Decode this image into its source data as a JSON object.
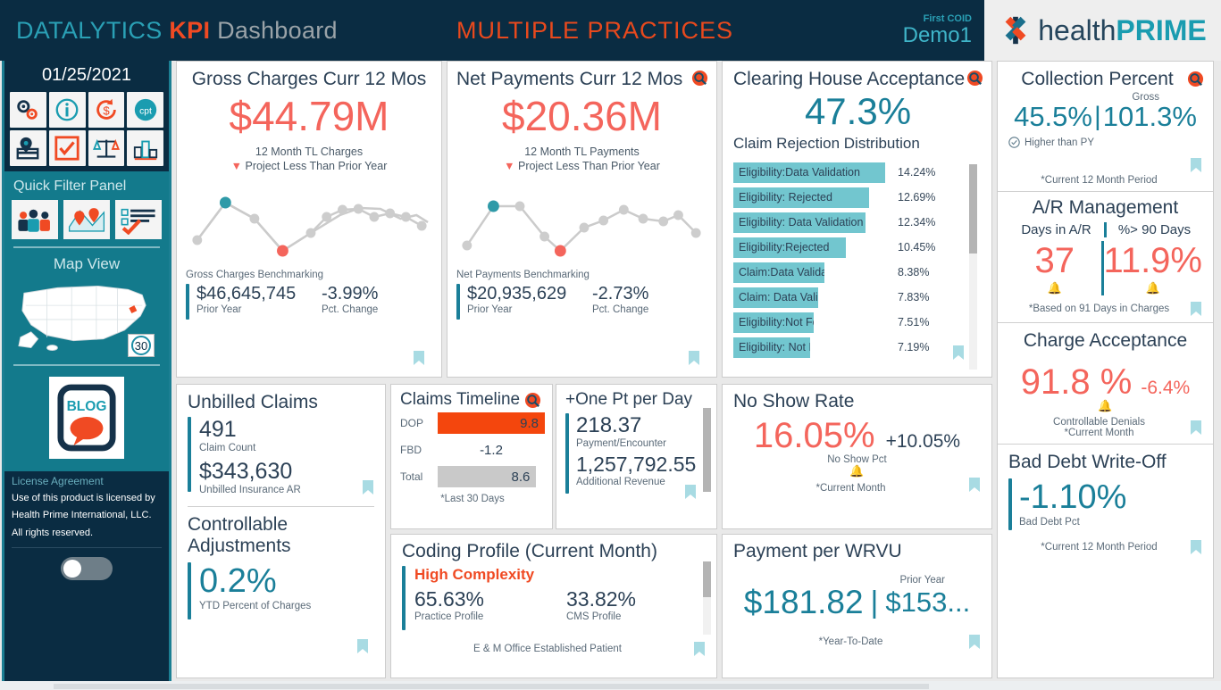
{
  "header": {
    "brand_1": "DATALYTICS",
    "brand_2": "KPI",
    "brand_3": "Dashboard",
    "center_title": "MULTIPLE PRACTICES",
    "coid_label": "First COID",
    "coid_value": "Demo1",
    "logo_1": "health",
    "logo_2": "PRIME",
    "accent_teal": "#1a9cb0",
    "accent_orange": "#f04a23",
    "bg": "#0a2c42"
  },
  "sidebar": {
    "date": "01/25/2021",
    "tiles": [
      {
        "name": "gears-icon"
      },
      {
        "name": "info-icon"
      },
      {
        "name": "refund-dollar-icon"
      },
      {
        "name": "cpt-icon"
      },
      {
        "name": "location-card-icon"
      },
      {
        "name": "checkbox-icon"
      },
      {
        "name": "scales-icon"
      },
      {
        "name": "podium-icon"
      }
    ],
    "quick_filter_title": "Quick Filter Panel",
    "quick_filter_icons": [
      {
        "name": "people-group-icon"
      },
      {
        "name": "map-pins-icon"
      },
      {
        "name": "checklist-icon"
      }
    ],
    "map_title": "Map View",
    "map_badge": "30",
    "blog_label": "BLOG",
    "license_title": "License Agreement",
    "license_text": "Use of this product is licensed by Health Prime International, LLC.  All rights reserved.",
    "toggle_state": "off"
  },
  "cards": {
    "gross_charges": {
      "title": "Gross Charges Curr 12 Mos",
      "value": "$44.79M",
      "sub1": "12 Month TL Charges",
      "trend_arrow": "▼",
      "sub2": "Project Less Than Prior Year",
      "bench_title": "Gross Charges Benchmarking",
      "prior_value": "$46,645,745",
      "prior_label": "Prior Year",
      "pct_value": "-3.99%",
      "pct_label": "Pct. Change"
    },
    "net_payments": {
      "title": "Net Payments Curr 12 Mos",
      "value": "$20.36M",
      "sub1": "12 Month TL Payments",
      "trend_arrow": "▼",
      "sub2": "Project Less Than Prior Year",
      "bench_title": "Net Payments Benchmarking",
      "prior_value": "$20,935,629",
      "prior_label": "Prior Year",
      "pct_value": "-2.73%",
      "pct_label": "Pct. Change"
    },
    "clearing_house": {
      "title": "Clearing House Acceptance",
      "value": "47.3%",
      "dist_title": "Claim Rejection Distribution",
      "rows": [
        {
          "label": "Eligibility:Data Validation",
          "pct": "14.24%"
        },
        {
          "label": "Eligibility: Rejected",
          "pct": "12.69%"
        },
        {
          "label": "Eligibility: Data Validation",
          "pct": "12.34%"
        },
        {
          "label": "Eligibility:Rejected",
          "pct": "10.45%"
        },
        {
          "label": "Claim:Data Validation",
          "pct": "8.38%"
        },
        {
          "label": "Claim: Data Validation",
          "pct": "7.83%"
        },
        {
          "label": "Eligibility:Not Found",
          "pct": "7.51%"
        },
        {
          "label": "Eligibility: Not Found",
          "pct": "7.19%"
        }
      ]
    },
    "collection_percent": {
      "title": "Collection Percent",
      "value": "45.5%",
      "gross_label": "Gross",
      "gross_value": "101.3%",
      "status": "Higher than PY",
      "note": "*Current 12 Month Period"
    },
    "ar_management": {
      "title": "A/R Management",
      "col1_label": "Days in A/R",
      "col2_label": "%> 90 Days",
      "col1_value": "37",
      "col2_value": "11.9%",
      "note": "*Based on 91 Days in Charges"
    },
    "charge_acceptance": {
      "title": "Charge Acceptance",
      "value": "91.8 %",
      "delta": "-6.4%",
      "sub": "Controllable Denials",
      "note": "*Current Month"
    },
    "bad_debt": {
      "title": "Bad Debt Write-Off",
      "value": "-1.10%",
      "sub": "Bad Debt Pct",
      "note": "*Current 12 Month Period"
    },
    "unbilled_claims": {
      "title": "Unbilled Claims",
      "value1": "491",
      "label1": "Claim Count",
      "value2": "$343,630",
      "label2": "Unbilled Insurance AR"
    },
    "controllable_adjustments": {
      "title": "Controllable Adjustments",
      "value": "0.2%",
      "label": "YTD Percent of Charges"
    },
    "claims_timeline": {
      "title": "Claims Timeline",
      "rows": [
        {
          "label": "DOP",
          "value": "9.8",
          "style": "orange"
        },
        {
          "label": "FBD",
          "value": "-1.2",
          "style": "plain"
        },
        {
          "label": "Total",
          "value": "8.6",
          "style": "gray"
        }
      ],
      "note": "*Last 30 Days"
    },
    "one_pt_per_day": {
      "title": "+One Pt per Day",
      "value1": "218.37",
      "label1": "Payment/Encounter",
      "value2": "1,257,792.55",
      "label2": "Additional Revenue"
    },
    "coding_profile": {
      "title": "Coding Profile (Current Month)",
      "complexity": "High Complexity",
      "value1": "65.63%",
      "label1": "Practice Profile",
      "value2": "33.82%",
      "label2": "CMS Profile",
      "footer": "E & M Office Established Patient"
    },
    "no_show_rate": {
      "title": "No Show Rate",
      "value": "16.05%",
      "delta": "+10.05%",
      "sub": "No Show Pct",
      "note": "*Current Month"
    },
    "payment_per_wrvu": {
      "title": "Payment per WRVU",
      "value": "$181.82",
      "prior_label": "Prior Year",
      "prior_value": "$153...",
      "note": "*Year-To-Date"
    }
  },
  "chart_data": [
    {
      "type": "line",
      "title": "Gross Charges Curr 12 Mos sparkline",
      "x": [
        1,
        2,
        3,
        4,
        5,
        6,
        7,
        8,
        9,
        10,
        11,
        12,
        13
      ],
      "values": [
        22,
        72,
        55,
        12,
        33,
        52,
        62,
        60,
        50,
        55,
        45,
        50,
        38
      ],
      "point_colors": [
        "#c9c9c9",
        "#2f9aa8",
        "#c9c9c9",
        "#f4655c",
        "#c9c9c9",
        "#c9c9c9",
        "#c9c9c9",
        "#c9c9c9",
        "#c9c9c9",
        "#c9c9c9",
        "#c9c9c9",
        "#c9c9c9",
        "#c9c9c9"
      ],
      "high_point_index": 1,
      "low_point_index": 3,
      "grid": false,
      "legend": "none"
    },
    {
      "type": "line",
      "title": "Net Payments Curr 12 Mos sparkline",
      "x": [
        1,
        2,
        3,
        4,
        5,
        6,
        7,
        8,
        9,
        10,
        11,
        12,
        13
      ],
      "values": [
        18,
        72,
        72,
        30,
        12,
        42,
        50,
        62,
        52,
        48,
        45,
        52,
        33
      ],
      "point_colors": [
        "#c9c9c9",
        "#2f9aa8",
        "#c9c9c9",
        "#c9c9c9",
        "#f4655c",
        "#c9c9c9",
        "#c9c9c9",
        "#c9c9c9",
        "#c9c9c9",
        "#c9c9c9",
        "#c9c9c9",
        "#c9c9c9",
        "#c9c9c9"
      ],
      "high_point_index": 1,
      "low_point_index": 4,
      "grid": false,
      "legend": "none"
    },
    {
      "type": "bar",
      "title": "Claim Rejection Distribution",
      "categories": [
        "Eligibility:Data Validation",
        "Eligibility: Rejected",
        "Eligibility: Data Validation",
        "Eligibility:Rejected",
        "Claim:Data Validation",
        "Claim: Data Validation",
        "Eligibility:Not Found",
        "Eligibility: Not Found"
      ],
      "values": [
        14.24,
        12.69,
        12.34,
        10.45,
        8.38,
        7.83,
        7.51,
        7.19
      ],
      "ylabel": "",
      "xlabel": "%",
      "grid": false,
      "legend": "none"
    },
    {
      "type": "bar",
      "title": "Claims Timeline",
      "categories": [
        "DOP",
        "FBD",
        "Total"
      ],
      "values": [
        9.8,
        -1.2,
        8.6
      ],
      "grid": false,
      "legend": "none"
    }
  ]
}
